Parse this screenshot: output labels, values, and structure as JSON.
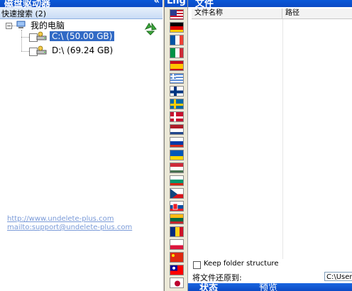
{
  "left_panel": {
    "title": "磁盘驱动器",
    "collapse_symbol": "«",
    "quick_search_label": "快速搜索 (2)",
    "tree": {
      "root_label": "我的电脑",
      "drives": [
        {
          "label": "C:\\  (50.00 GB)",
          "selected": true
        },
        {
          "label": "D:\\  (69.24 GB)",
          "selected": false
        }
      ]
    },
    "links": [
      "http://www.undelete-plus.com",
      "mailto:support@undelete-plus.com"
    ]
  },
  "lang_panel": {
    "title": "Lng",
    "flags": [
      "us",
      "de",
      "fr",
      "it",
      "es",
      "gr",
      "fi",
      "se",
      "dk",
      "nl",
      "ru",
      "ua",
      "hu",
      "bg",
      "cz",
      "sk",
      "lt",
      "ro",
      "pl",
      "cn",
      "tw",
      "jp"
    ]
  },
  "right_panel": {
    "title": "文件",
    "columns": [
      "文件名称",
      "路径"
    ],
    "keep_structure_label": "Keep folder structure",
    "restore_to_label": "将文件还原到:",
    "restore_path": "C:\\Users",
    "tabs": [
      "状态",
      "预览"
    ]
  },
  "colors": {
    "header_blue": "#0b4ac4",
    "selection_blue": "#316ac5",
    "link_color": "#7a9ad8"
  }
}
